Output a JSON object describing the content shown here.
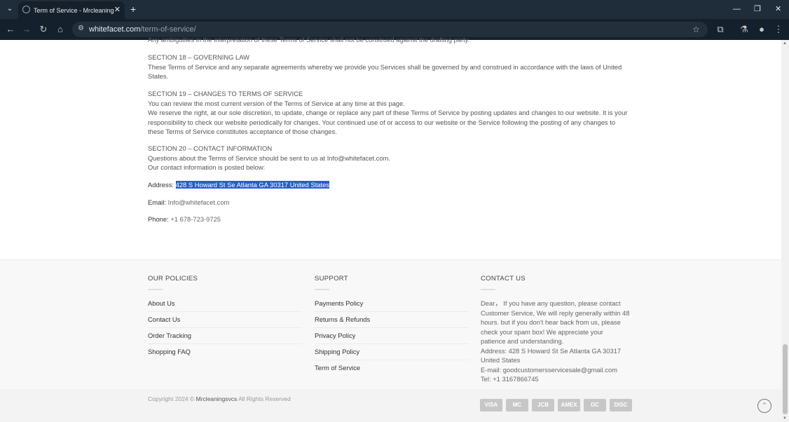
{
  "browser": {
    "tab_title": "Term of Service - Mrcleaningsvcs",
    "url_host": "whitefacet.com",
    "url_path": "/term-of-service/"
  },
  "page": {
    "clipped_line": "Any ambiguities in the interpretation of these Terms of Service shall not be construed against the drafting party.",
    "section18_title": "SECTION 18 – GOVERNING LAW",
    "section18_body": "These Terms of Service and any separate agreements whereby we provide you Services shall be governed by and construed in accordance with the laws of United States.",
    "section19_title": "SECTION 19 – CHANGES TO TERMS OF SERVICE",
    "section19_p1": "You can review the most current version of the Terms of Service at any time at this page.",
    "section19_p2": "We reserve the right, at our sole discretion, to update, change or replace any part of these Terms of Service by posting updates and changes to our website. It is your responsibility to check our website periodically for changes. Your continued use of or access to our website or the Service following the posting of any changes to these Terms of Service constitutes acceptance of those changes.",
    "section20_title": "SECTION 20 – CONTACT INFORMATION",
    "section20_p1": "Questions about the Terms of Service should be sent to us at Info@whitefacet.com.",
    "section20_p2": "Our contact information is posted below:",
    "address_label": "Address:",
    "address_value": "428 S Howard St Se Atlanta GA 30317 United States",
    "email_label": "Email:",
    "email_value": "Info@whitefacet.com",
    "phone_label": "Phone:",
    "phone_value": "+1 678-723-9725"
  },
  "footer": {
    "policies_heading": "OUR POLICIES",
    "policies": [
      "About Us",
      "Contact Us",
      "Order Tracking",
      "Shopping FAQ"
    ],
    "support_heading": "SUPPORT",
    "support": [
      "Payments Policy",
      "Returns & Refunds",
      "Privacy Policy",
      "Shipping Policy",
      "Term of Service"
    ],
    "contact_heading": "CONTACT US",
    "contact_lines": [
      "Dear，  If you have any question, please contact",
      "Customer Service, We will reply generally within 48",
      "hours. but if you don't hear back from us, please",
      "check your spam box! We appreciate your",
      "patience and understanding.",
      "Address: 428 S Howard St Se Atlanta GA 30317",
      "United States",
      "E-mail: goodcustomersservicesale@gmail.com",
      "Tel: +1 3167866745"
    ],
    "copyright_prefix": "Copyright 2024 © ",
    "copyright_brand": "Mrcleaningsvcs",
    "copyright_suffix": " All Rights Reserved",
    "payments": [
      "VISA",
      "MC",
      "JCB",
      "AMEX",
      "DC",
      "DISC"
    ]
  }
}
